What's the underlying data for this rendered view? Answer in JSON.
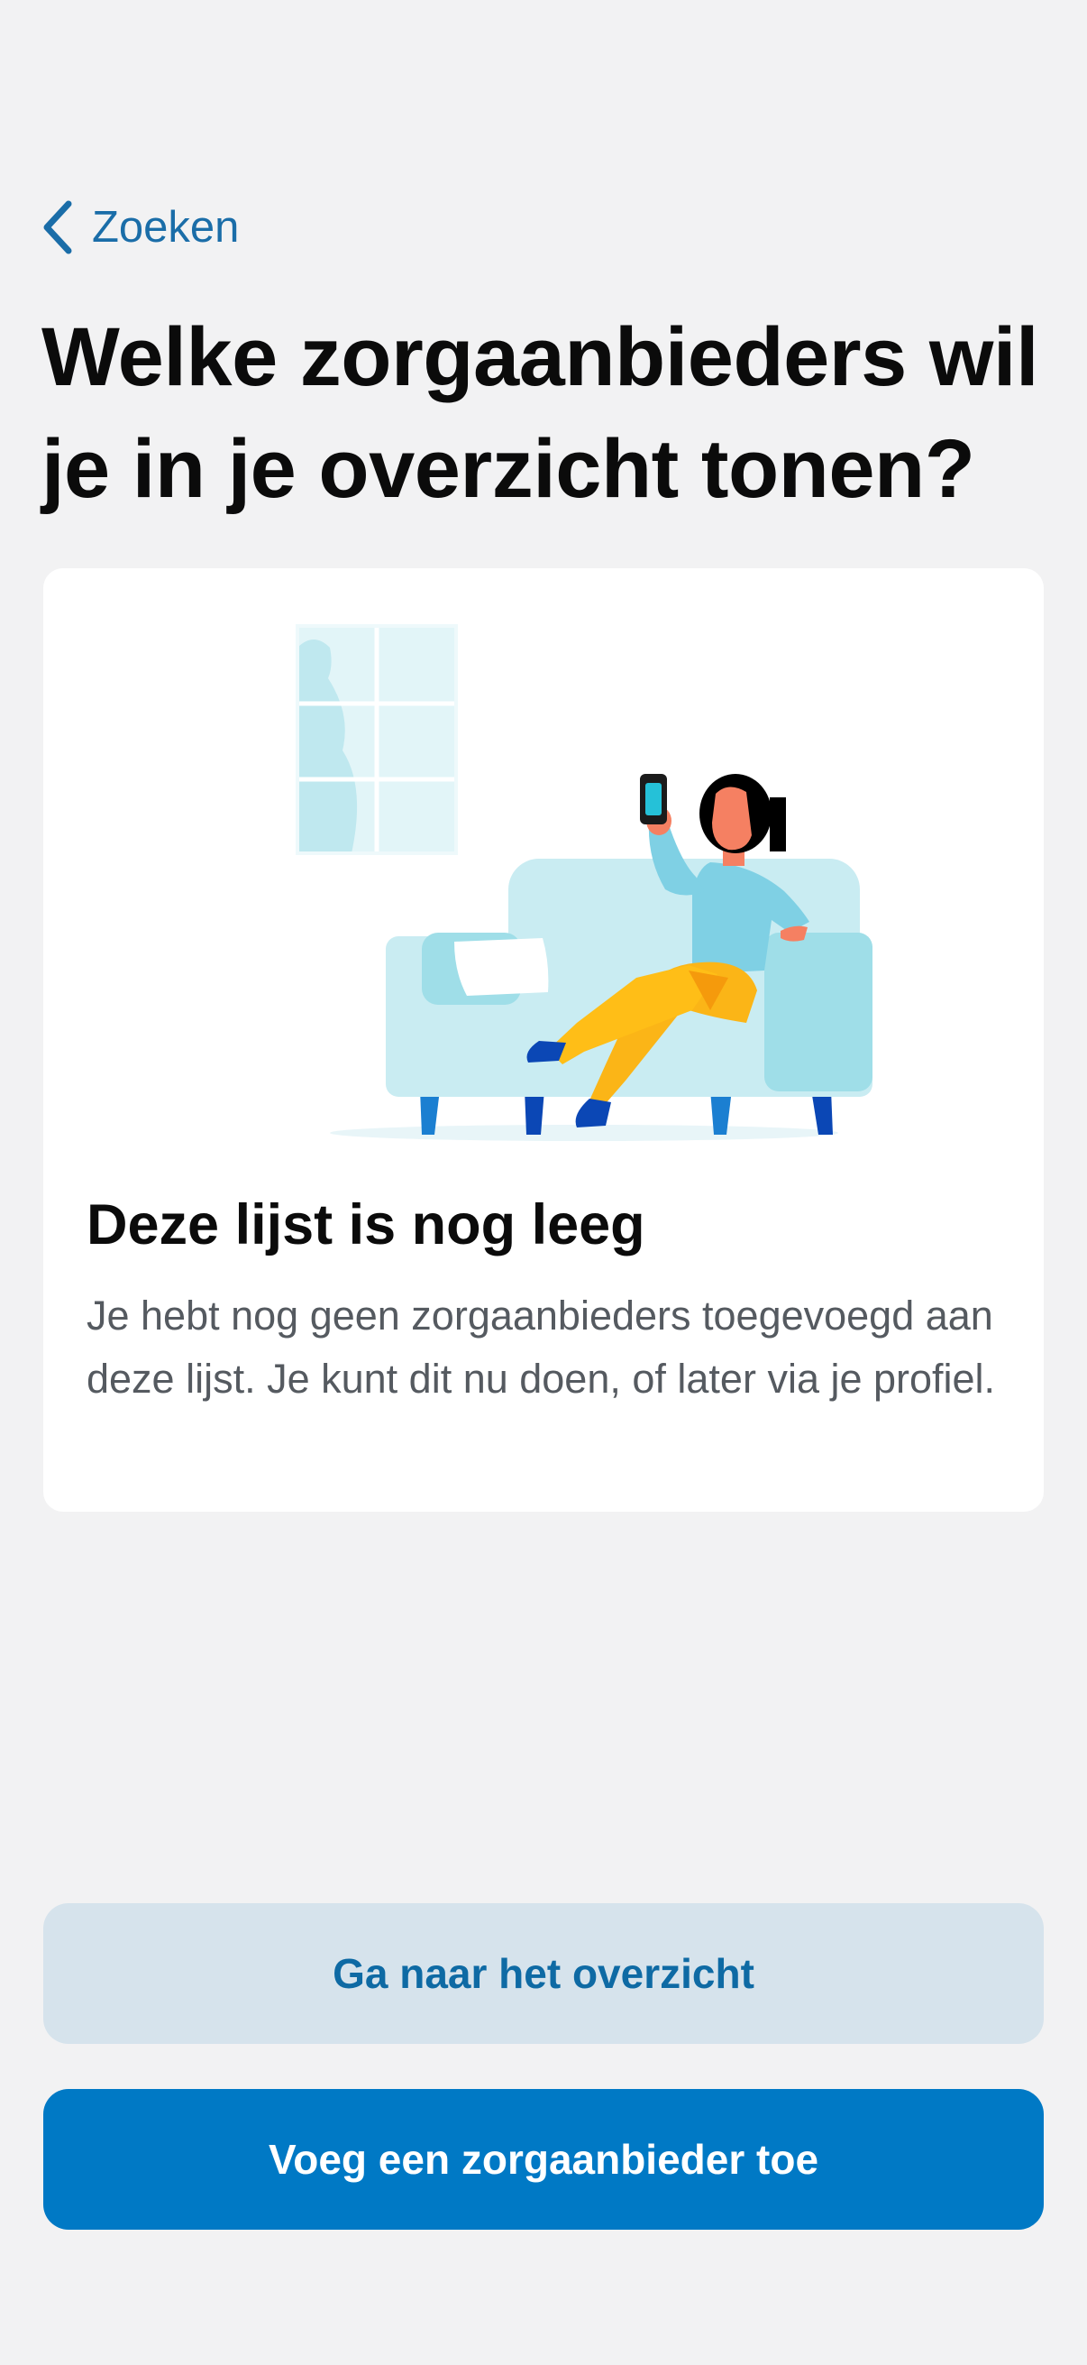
{
  "nav": {
    "back_label": "Zoeken"
  },
  "page": {
    "title": "Welke zorgaanbieders wil je in je overzicht tonen?"
  },
  "empty_state": {
    "illustration": "woman-on-sofa-with-phone",
    "title": "Deze lijst is nog leeg",
    "body": "Je hebt nog geen zorgaanbieders toegevoegd aan deze lijst. Je kunt dit nu doen, of later via je profiel."
  },
  "actions": {
    "secondary_label": "Ga naar het overzicht",
    "primary_label": "Voeg een zorgaanbieder toe"
  },
  "colors": {
    "background": "#f2f2f3",
    "link": "#1a6da8",
    "primary_button": "#0079c5",
    "secondary_button": "#d6e3ec"
  }
}
